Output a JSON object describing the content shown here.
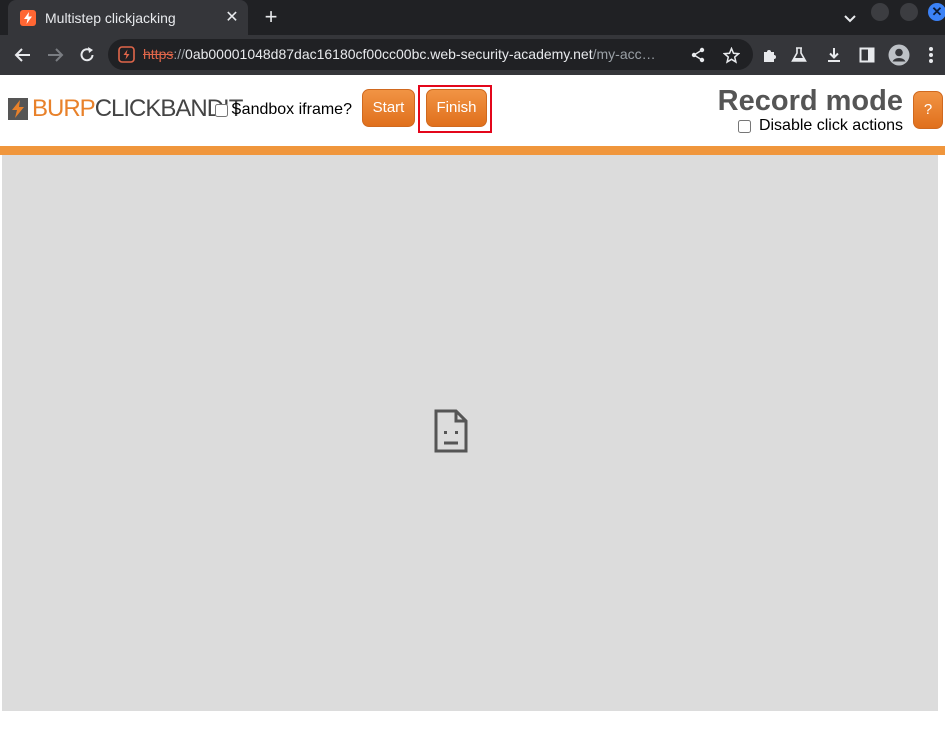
{
  "browser": {
    "tab": {
      "title": "Multistep clickjacking",
      "favicon": "burp-lightning-icon"
    },
    "address_bar": {
      "scheme": "https",
      "separator": "://",
      "host": "0ab00001048d87dac16180cf00cc00bc.web-security-academy.net",
      "path": "/my-acc…"
    },
    "colors": {
      "tabstrip": "#202124",
      "toolbar": "#35363a",
      "close_button": "#3b82f6"
    }
  },
  "clickbandit": {
    "logo": {
      "part1": "BURP",
      "part2": "CLICKBANDIT"
    },
    "sandbox_label": "Sandbox iframe?",
    "start_label": "Start",
    "finish_label": "Finish",
    "mode_title": "Record mode",
    "disable_label": "Disable click actions",
    "help_label": "?",
    "colors": {
      "accent": "#f0963c",
      "button": "#e0701c",
      "highlight": "#e3061b",
      "frame_background": "#dcdcdc"
    }
  },
  "frame": {
    "state_icon": "sad-page-icon"
  }
}
